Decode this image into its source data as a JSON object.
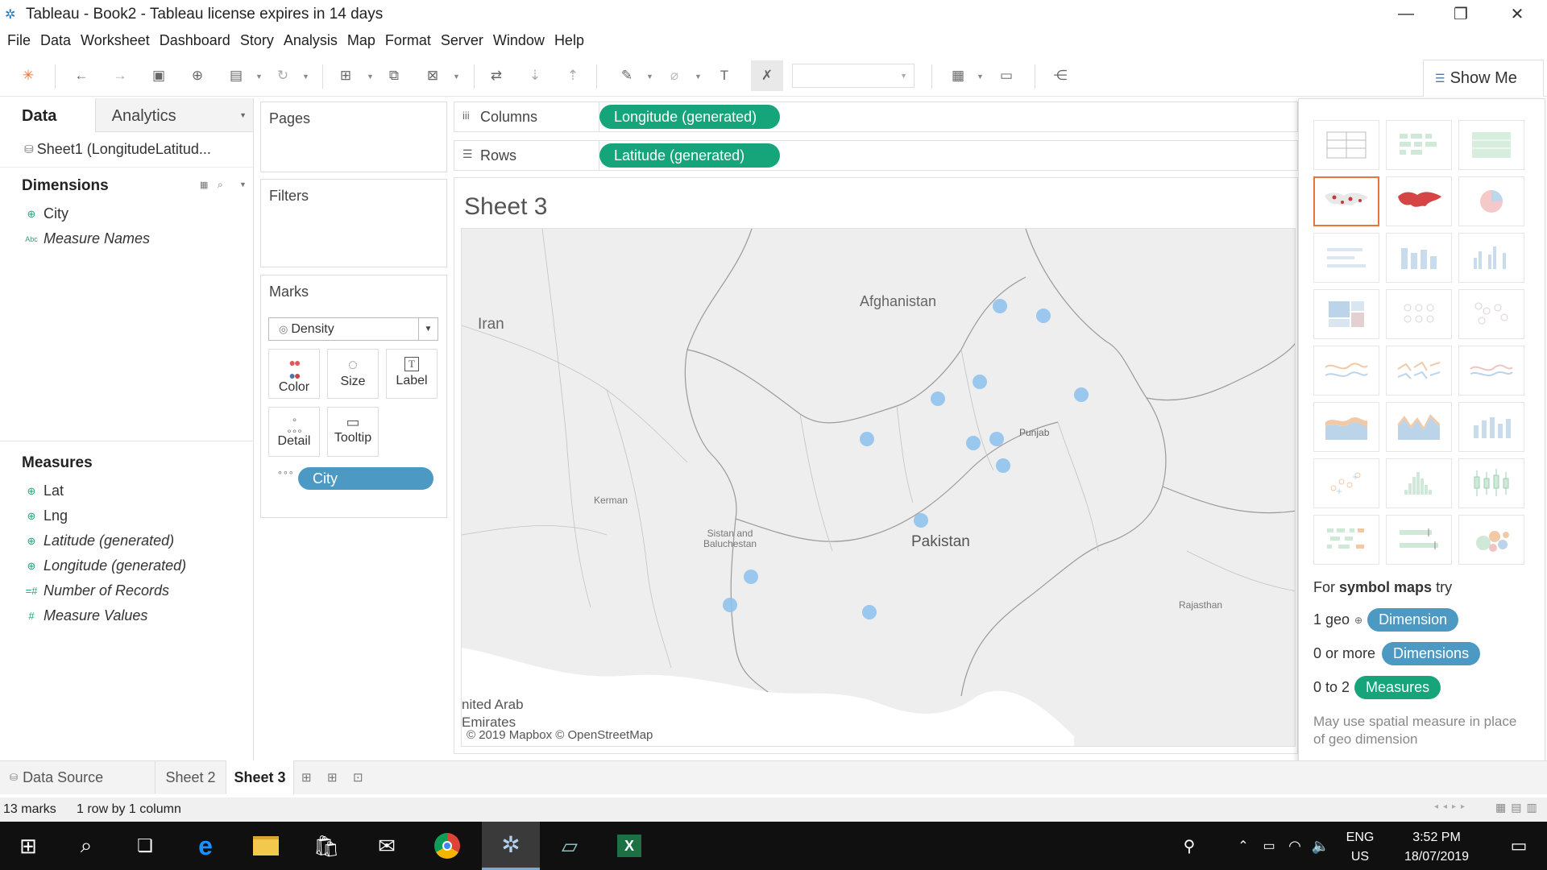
{
  "window": {
    "title": "Tableau - Book2 - Tableau license expires in 14 days"
  },
  "menu": [
    "File",
    "Data",
    "Worksheet",
    "Dashboard",
    "Story",
    "Analysis",
    "Map",
    "Format",
    "Server",
    "Window",
    "Help"
  ],
  "showme_button": "Show Me",
  "data_pane": {
    "tab_data": "Data",
    "tab_analytics": "Analytics",
    "datasource": "Sheet1 (LongitudeLatitud...",
    "dimensions_title": "Dimensions",
    "dimensions": [
      {
        "icon": "globe-icon",
        "label": "City"
      },
      {
        "icon": "abc-icon",
        "label": "Measure Names"
      }
    ],
    "measures_title": "Measures",
    "measures": [
      {
        "icon": "globe-icon",
        "label": "Lat"
      },
      {
        "icon": "globe-icon",
        "label": "Lng"
      },
      {
        "icon": "globe-icon",
        "label": "Latitude (generated)"
      },
      {
        "icon": "globe-icon",
        "label": "Longitude (generated)"
      },
      {
        "icon": "hash-icon",
        "label": "Number of Records"
      },
      {
        "icon": "hash-icon",
        "label": "Measure Values"
      }
    ]
  },
  "cards": {
    "pages": "Pages",
    "filters": "Filters",
    "marks": "Marks",
    "mark_type": "Density",
    "mark_buttons": [
      "Color",
      "Size",
      "Label",
      "Detail",
      "Tooltip"
    ],
    "city_pill": "City"
  },
  "shelves": {
    "columns_label": "Columns",
    "columns_pill": "Longitude (generated)",
    "rows_label": "Rows",
    "rows_pill": "Latitude (generated)"
  },
  "sheet": {
    "title": "Sheet 3"
  },
  "map": {
    "labels": {
      "afghanistan": "Afghanistan",
      "iran": "Iran",
      "punjab": "Punjab",
      "kerman": "Kerman",
      "sistan": "Sistan and\nBaluchestan",
      "pakistan": "Pakistan",
      "rajasthan": "Rajasthan",
      "uae": "nited Arab\nEmirates"
    },
    "attribution": "© 2019 Mapbox © OpenStreetMap",
    "point_color": "#8fc2ec"
  },
  "showme": {
    "hint_prefix": "For",
    "hint_bold": "symbol maps",
    "hint_suffix": "try",
    "req1_label": "1 geo",
    "req1_pill": "Dimension",
    "req2_label": "0 or more",
    "req2_pill": "Dimensions",
    "req3_label": "0 to 2",
    "req3_pill": "Measures",
    "note": "May use spatial measure in place of geo dimension",
    "selected_index": 3
  },
  "sheet_tabs": {
    "datasource": "Data Source",
    "tabs": [
      "Sheet 2",
      "Sheet 3"
    ],
    "active": "Sheet 3"
  },
  "status": {
    "marks": "13 marks",
    "layout": "1 row by 1 column"
  },
  "taskbar": {
    "lang1": "ENG",
    "lang2": "US",
    "time": "3:52 PM",
    "date": "18/07/2019"
  },
  "colors": {
    "accent_green": "#16a57a",
    "accent_blue": "#4c9ac4",
    "selected_border": "#e8743b"
  }
}
